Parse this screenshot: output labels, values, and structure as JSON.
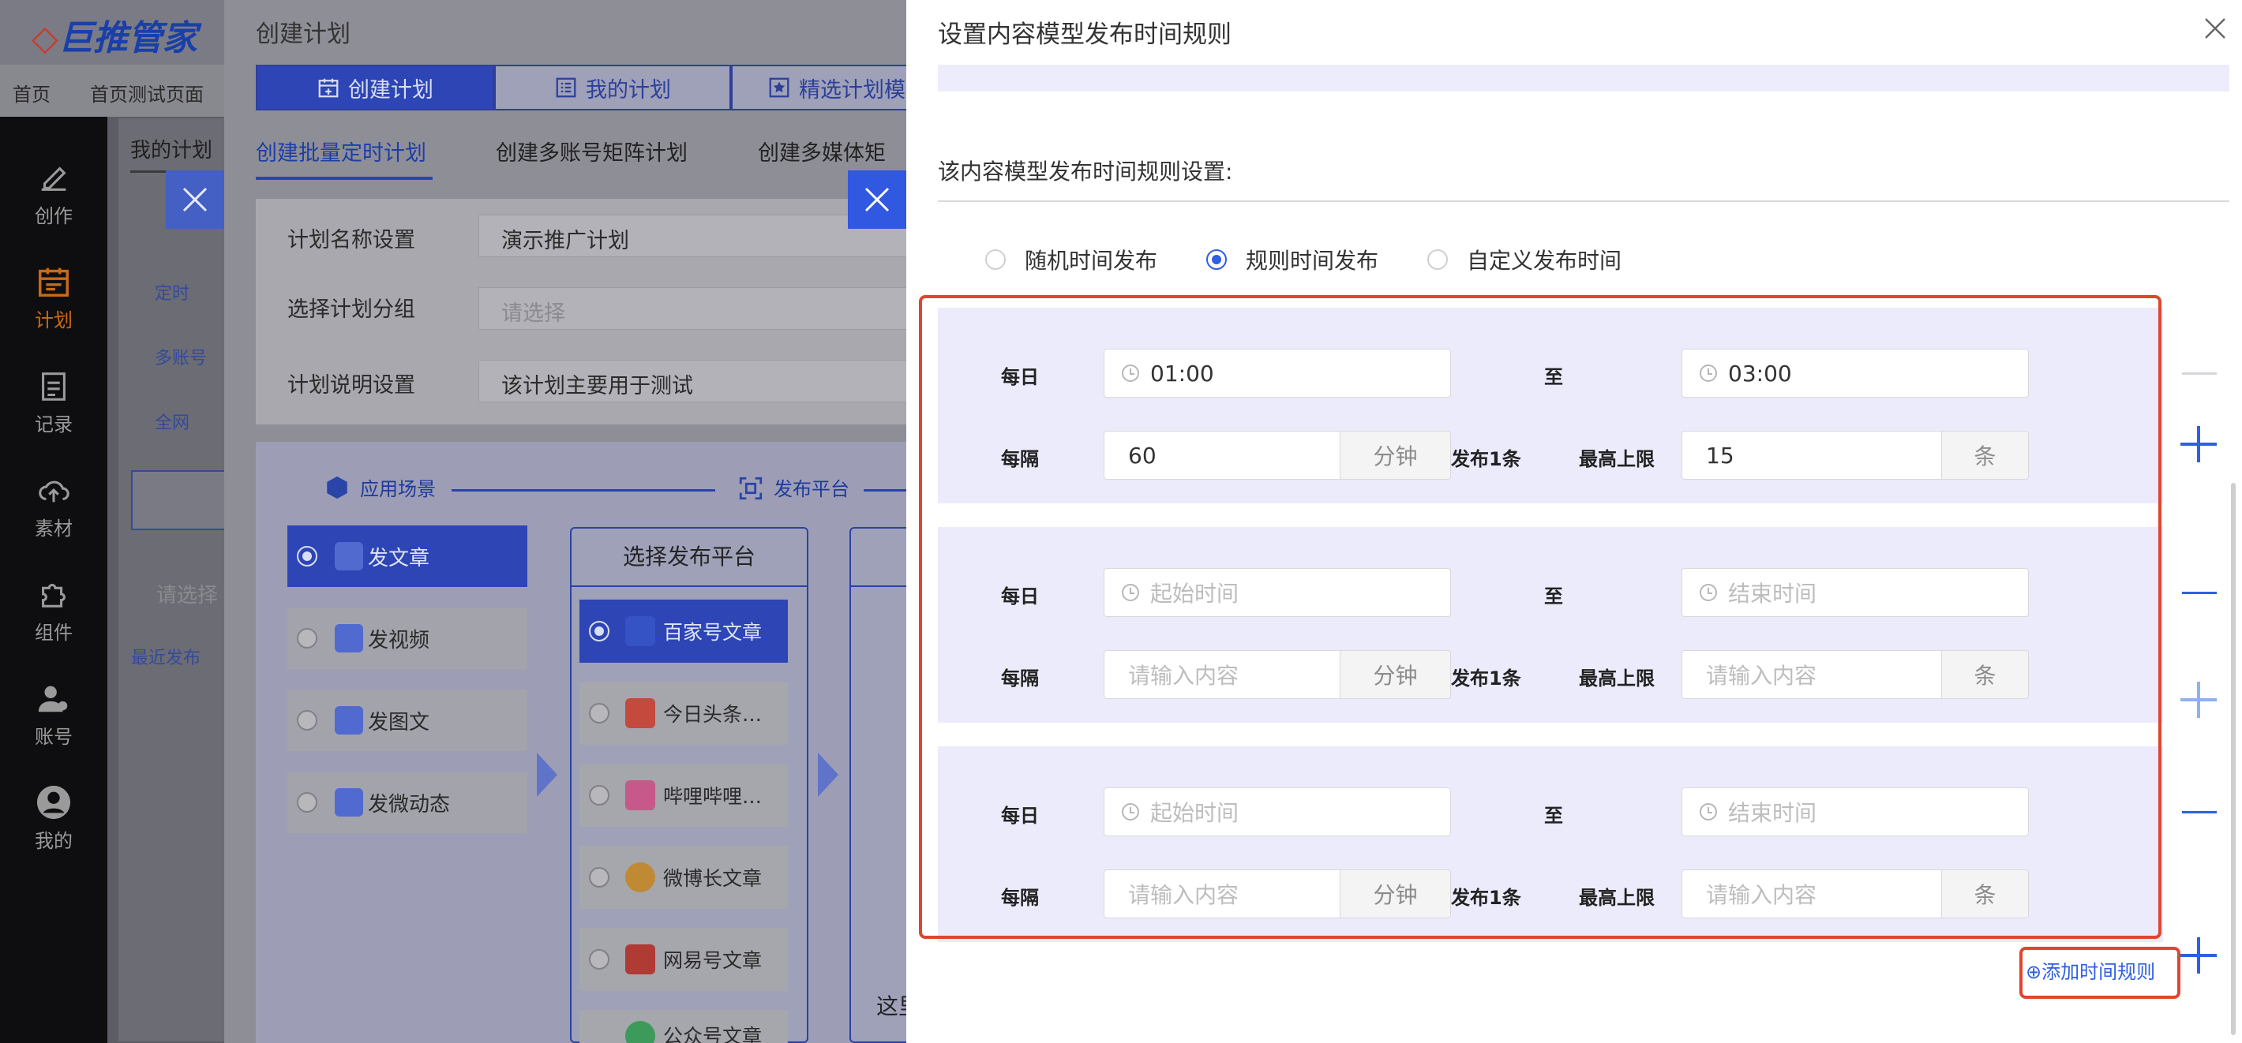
{
  "app": {
    "logo_text": "巨推管家",
    "breadcrumb": [
      "首页",
      "首页测试页面"
    ],
    "bg_tabs": [
      "我的计划"
    ],
    "nav": [
      {
        "label": "创作",
        "icon": "pen-icon"
      },
      {
        "label": "计划",
        "icon": "calendar-icon",
        "active": true
      },
      {
        "label": "记录",
        "icon": "clipboard-icon"
      },
      {
        "label": "素材",
        "icon": "cloud-upload-icon"
      },
      {
        "label": "组件",
        "icon": "puzzle-icon"
      },
      {
        "label": "账号",
        "icon": "user-group-icon"
      },
      {
        "label": "我的",
        "icon": "user-icon"
      }
    ],
    "bg_fragments": [
      "定时",
      "多账号",
      "全网",
      "请选择",
      "最近发布"
    ]
  },
  "plan_drawer": {
    "title": "创建计划",
    "tabs": [
      "创建计划",
      "我的计划",
      "精选计划模"
    ],
    "subtabs": [
      "创建批量定时计划",
      "创建多账号矩阵计划",
      "创建多媒体矩"
    ],
    "form": {
      "name_label": "计划名称设置",
      "name_value": "演示推广计划",
      "group_label": "选择计划分组",
      "group_placeholder": "请选择",
      "desc_label": "计划说明设置",
      "desc_value": "该计划主要用于测试"
    },
    "flow": {
      "step1": "应用场景",
      "step2": "发布平台",
      "scenes": [
        "发文章",
        "发视频",
        "发图文",
        "发微动态"
      ],
      "platform_header": "选择发布平台",
      "platforms": [
        "百家号文章",
        "今日头条…",
        "哔哩哔哩…",
        "微博长文章",
        "网易号文章",
        "公众号文章"
      ],
      "fragment": "这里"
    }
  },
  "rule_drawer": {
    "title": "设置内容模型发布时间规则",
    "section_label": "该内容模型发布时间规则设置:",
    "options": [
      {
        "label": "随机时间发布",
        "selected": false
      },
      {
        "label": "规则时间发布",
        "selected": true
      },
      {
        "label": "自定义发布时间",
        "selected": false
      }
    ],
    "labels": {
      "daily": "每日",
      "to": "至",
      "every": "每隔",
      "minute_unit": "分钟",
      "post_once": "发布1条",
      "max_limit": "最高上限",
      "count_unit": "条"
    },
    "placeholders": {
      "start": "起始时间",
      "end": "结束时间",
      "input": "请输入内容"
    },
    "rules": [
      {
        "start": "01:00",
        "end": "03:00",
        "interval": "60",
        "max": "15"
      },
      {
        "start": "",
        "end": "",
        "interval": "",
        "max": ""
      },
      {
        "start": "",
        "end": "",
        "interval": "",
        "max": ""
      }
    ],
    "add_rule": "⊕添加时间规则",
    "colors": {
      "accent": "#2f5fe2",
      "highlight": "#e0452f",
      "rule_bg": "#ebebfc"
    }
  }
}
